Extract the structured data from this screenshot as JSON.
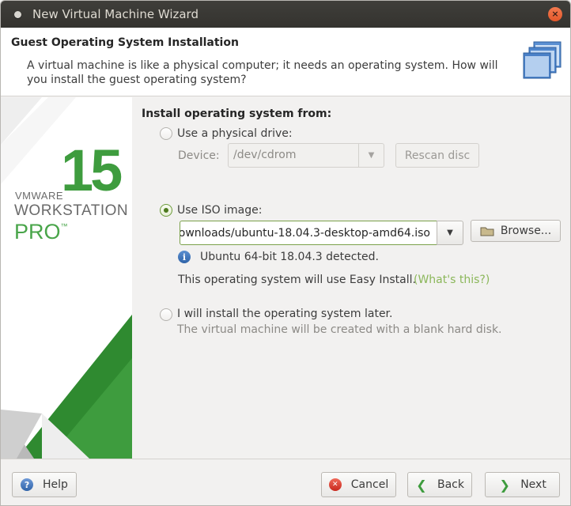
{
  "window": {
    "title": "New Virtual Machine Wizard",
    "close_glyph": "×"
  },
  "header": {
    "title": "Guest Operating System Installation",
    "description": "A virtual machine is like a physical computer; it needs an operating system. How will you install the guest operating system?",
    "icon": "stacked-windows-icon"
  },
  "brand": {
    "vendor": "VMWARE",
    "version": "15",
    "product": "WORKSTATION",
    "edition": "PRO",
    "tm": "™",
    "accent": "#3e9c3e"
  },
  "install": {
    "section_label": "Install operating system from:",
    "physical": {
      "label": "Use a physical drive:",
      "device_label": "Device:",
      "device_value": "/dev/cdrom",
      "rescan_label": "Rescan disc",
      "selected": false
    },
    "iso": {
      "label": "Use ISO image:",
      "path_value": "ownloads/ubuntu-18.04.3-desktop-amd64.iso",
      "browse_label": "Browse...",
      "detected_text": "Ubuntu 64-bit 18.04.3 detected.",
      "easy_install_text": "This operating system will use Easy Install.",
      "whats_this_link": "(What's this?)",
      "selected": true
    },
    "later": {
      "label": "I will install the operating system later.",
      "sub_text": "The virtual machine will be created with a blank hard disk.",
      "selected": false
    }
  },
  "footer": {
    "help_label": "Help",
    "cancel_label": "Cancel",
    "back_label": "Back",
    "next_label": "Next"
  }
}
